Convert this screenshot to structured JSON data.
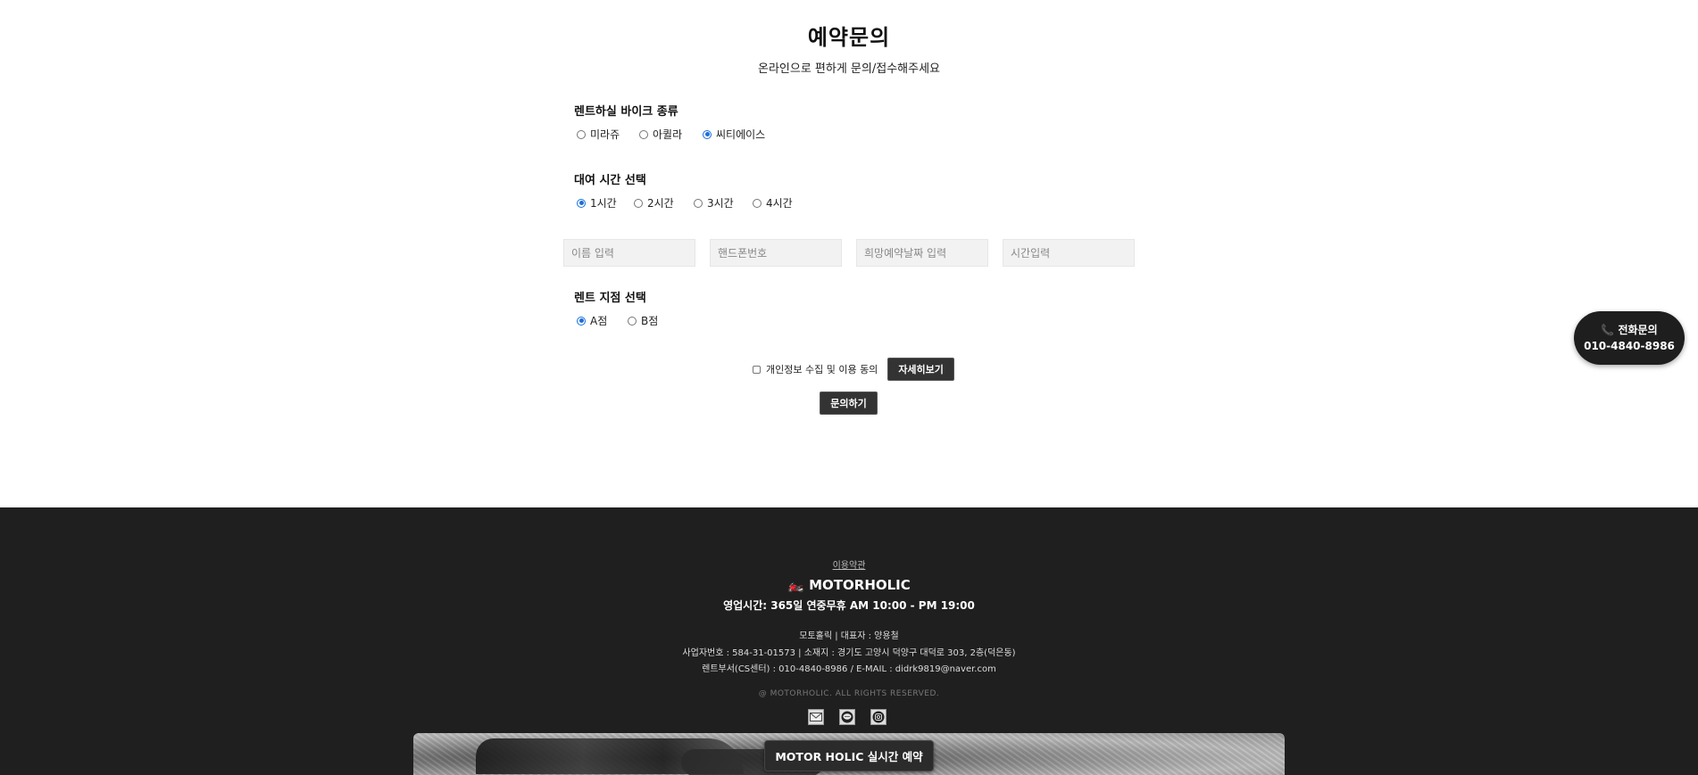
{
  "header": {
    "title": "예약문의",
    "subtitle": "온라인으로 편하게 문의/접수해주세요"
  },
  "bike_type": {
    "label": "렌트하실 바이크 종류",
    "options": [
      "미라쥬",
      "아퀼라",
      "씨티에이스"
    ],
    "selected": "씨티에이스"
  },
  "rental_time": {
    "label": "대여 시간 선택",
    "options": [
      "1시간",
      "2시간",
      "3시간",
      "4시간"
    ],
    "selected": "1시간"
  },
  "inputs": {
    "name_placeholder": "이름 입력",
    "phone_placeholder": "핸드폰번호",
    "date_placeholder": "희망예약날짜 입력",
    "time_placeholder": "시간입력"
  },
  "branch": {
    "label": "렌트 지점 선택",
    "options": [
      "A점",
      "B점"
    ],
    "selected": "A점"
  },
  "privacy": {
    "checkbox_label": "개인정보 수집 및 이용 동의",
    "checked": false,
    "detail_button": "자세히보기"
  },
  "submit_button": "문의하기",
  "phone_float": {
    "line1": "📞 전화문의",
    "line2": "010-4840-8986"
  },
  "footer": {
    "terms_link": "이용약관",
    "brand": "🏍️ MOTORHOLIC",
    "hours": "영업시간: 365일 연중무휴 AM 10:00 - PM 19:00",
    "info_lines": [
      "모토홀릭 | 대표자 : 양용철",
      "사업자번호 : 584-31-01573 | 소재지 : 경기도 고양시 덕양구 대덕로 303, 2층(덕은동)",
      "렌트부서(CS센터) : 010-4840-8986 / E-MAIL : didrk9819@naver.com"
    ],
    "copyright": "@ MOTORHOLIC. ALL RIGHTS RESERVED.",
    "icons": [
      "mail-icon",
      "chat-icon",
      "instagram-icon"
    ],
    "reserve_button": "MOTOR HOLIC 실시간 예약"
  }
}
